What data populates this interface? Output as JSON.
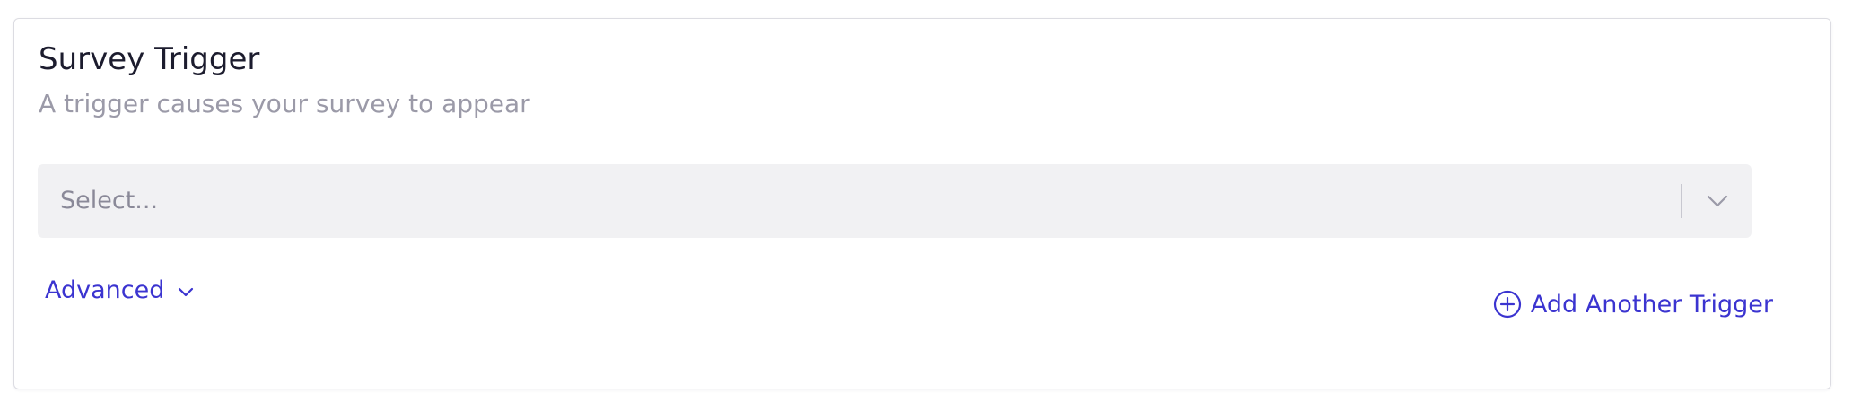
{
  "card": {
    "title": "Survey Trigger",
    "subtitle": "A trigger causes your survey to appear"
  },
  "trigger_select": {
    "placeholder": "Select..."
  },
  "advanced": {
    "label": "Advanced"
  },
  "add_trigger": {
    "label": "Add Another Trigger"
  },
  "colors": {
    "accent": "#3b34d0",
    "title_text": "#1c1c2e",
    "muted_text": "#9b9aa8",
    "select_bg": "#f1f1f3",
    "card_border": "#dcdce2"
  },
  "icons": {
    "select_chevron": "chevron-down-icon",
    "advanced_chevron": "chevron-down-icon",
    "add_trigger": "plus-circle-icon"
  }
}
